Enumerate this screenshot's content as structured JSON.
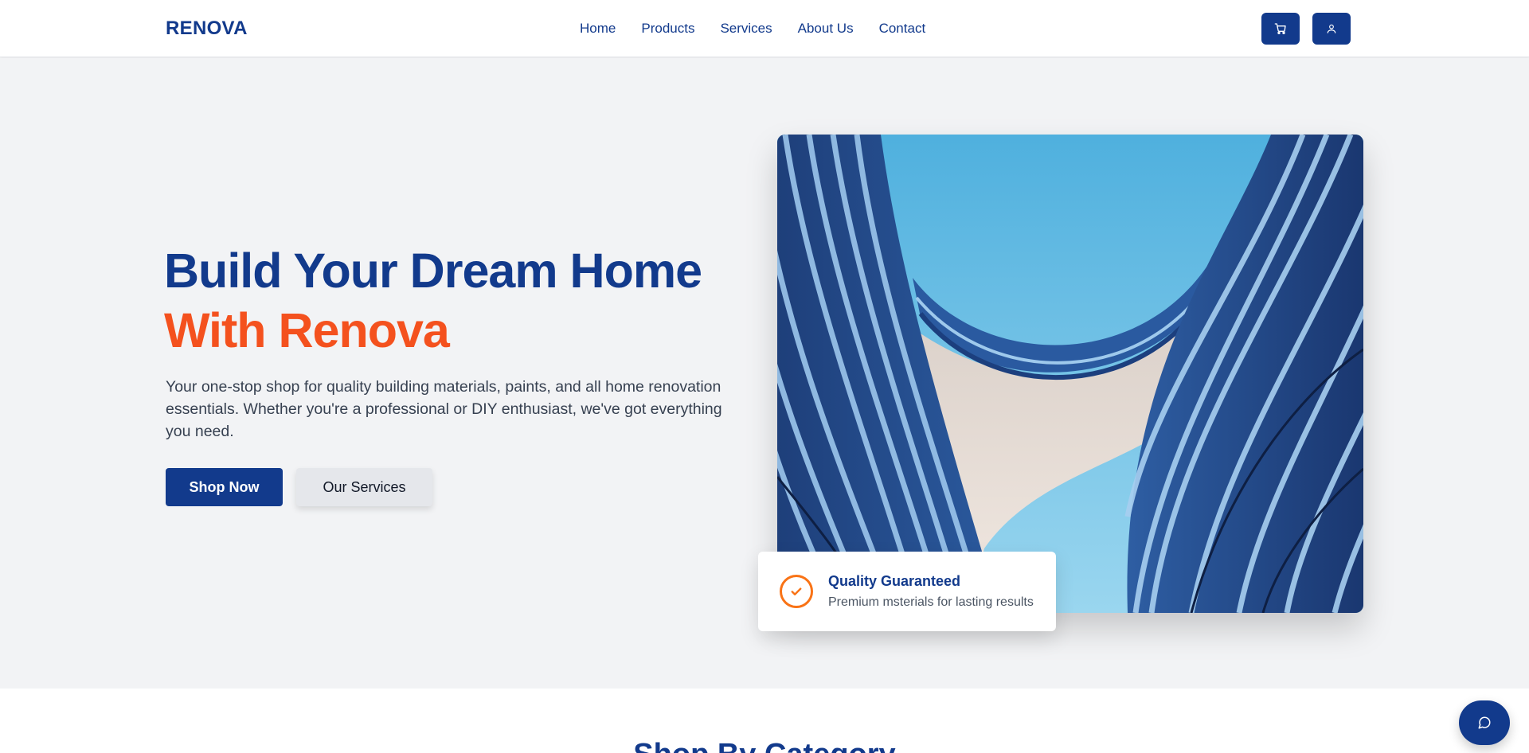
{
  "header": {
    "logo": "RENOVA",
    "nav": [
      "Home",
      "Products",
      "Services",
      "About Us",
      "Contact"
    ],
    "cart_icon": "cart-icon",
    "user_icon": "user-icon"
  },
  "hero": {
    "title_line1": "Build Your Dream Home",
    "title_line2": "With Renova",
    "description": "Your one-stop shop for quality building materials, paints, and all home renovation essentials. Whether you're a professional or DIY enthusiast, we've got everything you need.",
    "primary_button": "Shop Now",
    "secondary_button": "Our Services",
    "badge": {
      "icon": "check-circle-icon",
      "title": "Quality Guaranteed",
      "subtitle": "Premium msterials for lasting results"
    }
  },
  "section": {
    "title": "Shop By Category"
  },
  "chat": {
    "icon": "chat-icon"
  },
  "colors": {
    "brand": "#123a8c",
    "accent": "#f4511e",
    "badge_accent": "#f97316"
  }
}
